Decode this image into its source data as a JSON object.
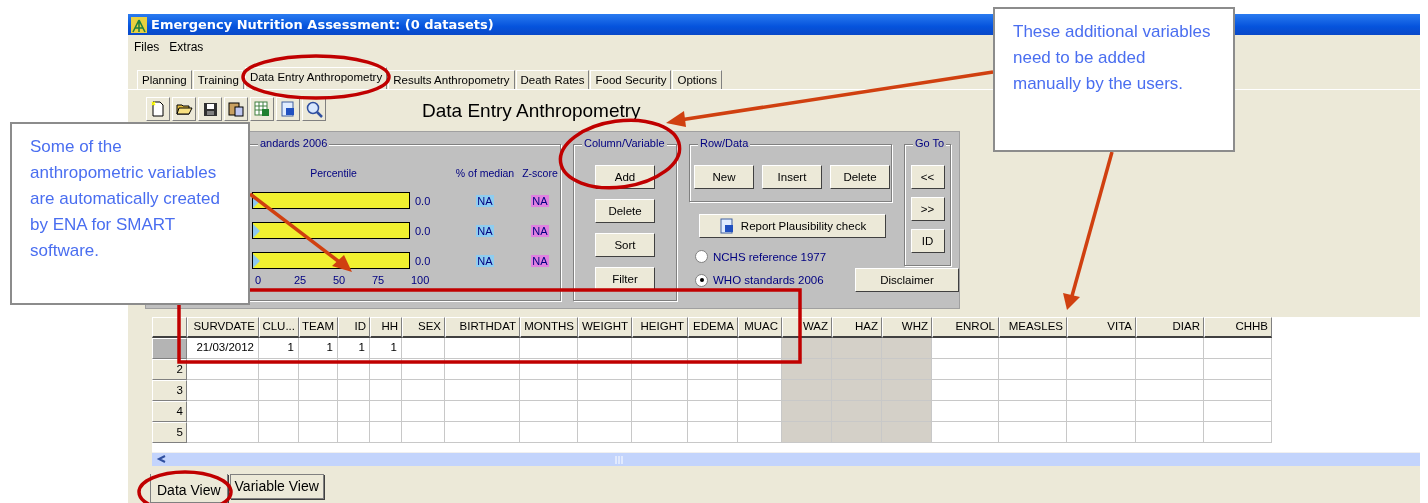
{
  "window": {
    "title": "Emergency Nutrition Assessment:  (0 datasets)"
  },
  "menu": [
    "Files",
    "Extras"
  ],
  "tabs": [
    {
      "label": "Planning",
      "selected": false
    },
    {
      "label": "Training",
      "selected": false
    },
    {
      "label": "Data Entry Anthropometry",
      "selected": true
    },
    {
      "label": "Results Anthropometry",
      "selected": false
    },
    {
      "label": "Death Rates",
      "selected": false
    },
    {
      "label": "Food Security",
      "selected": false
    },
    {
      "label": "Options",
      "selected": false
    }
  ],
  "toolbar": [
    {
      "kind": "new"
    },
    {
      "kind": "open"
    },
    {
      "kind": "save"
    },
    {
      "kind": "clipboard"
    },
    {
      "kind": "spreadsheet"
    },
    {
      "kind": "document"
    },
    {
      "kind": "formula"
    }
  ],
  "page_title": "Data Entry Anthropometry",
  "indicator_group": {
    "title": "andards 2006",
    "header_percentile": "Percentile",
    "header_median": "% of median",
    "header_zscore": "Z-score",
    "rows": [
      {
        "level": 0,
        "value": "0.0",
        "median": "NA",
        "zscore": "NA"
      },
      {
        "level": 0,
        "value": "0.0",
        "median": "NA",
        "zscore": "NA"
      },
      {
        "level": 0,
        "value": "0.0",
        "median": "NA",
        "zscore": "NA"
      }
    ],
    "scale": [
      "0",
      "25",
      "50",
      "75",
      "100"
    ]
  },
  "column_group": {
    "title": "Column/Variable",
    "buttons": [
      "Add",
      "Delete",
      "Sort",
      "Filter"
    ]
  },
  "row_group": {
    "title": "Row/Data",
    "buttons": [
      "New",
      "Insert",
      "Delete"
    ]
  },
  "report_button": "Report Plausibility check",
  "references": [
    {
      "label": "NCHS reference 1977",
      "selected": false
    },
    {
      "label": "WHO standards 2006",
      "selected": true
    }
  ],
  "goto_group": {
    "title": "Go To",
    "buttons": [
      "<<",
      ">>",
      "ID"
    ]
  },
  "disclaimer_button": "Disclaimer",
  "grid": {
    "columns": [
      {
        "label": "SURVDATE",
        "kind": "input"
      },
      {
        "label": "CLU...",
        "kind": "input"
      },
      {
        "label": "TEAM",
        "kind": "input"
      },
      {
        "label": "ID",
        "kind": "input"
      },
      {
        "label": "HH",
        "kind": "input"
      },
      {
        "label": "SEX",
        "kind": "input"
      },
      {
        "label": "BIRTHDAT",
        "kind": "input"
      },
      {
        "label": "MONTHS",
        "kind": "input"
      },
      {
        "label": "WEIGHT",
        "kind": "input"
      },
      {
        "label": "HEIGHT",
        "kind": "input"
      },
      {
        "label": "EDEMA",
        "kind": "input"
      },
      {
        "label": "MUAC",
        "kind": "input"
      },
      {
        "label": "WAZ",
        "kind": "computed"
      },
      {
        "label": "HAZ",
        "kind": "computed"
      },
      {
        "label": "WHZ",
        "kind": "computed"
      },
      {
        "label": "ENROL",
        "kind": "input"
      },
      {
        "label": "MEASLES",
        "kind": "input"
      },
      {
        "label": "VITA",
        "kind": "input"
      },
      {
        "label": "DIAR",
        "kind": "input"
      },
      {
        "label": "CHHB",
        "kind": "input"
      }
    ],
    "rows": [
      {
        "selected": true,
        "cells": [
          "21/03/2012",
          "1",
          "1",
          "1",
          "1"
        ]
      },
      {
        "number": "2",
        "selected": false,
        "cells": []
      },
      {
        "number": "3",
        "selected": false,
        "cells": []
      },
      {
        "number": "4",
        "selected": false,
        "cells": []
      },
      {
        "number": "5",
        "selected": false,
        "cells": []
      }
    ]
  },
  "view_tabs": [
    {
      "label": "Data View",
      "selected": true
    },
    {
      "label": "Variable View",
      "selected": false
    }
  ],
  "callouts": [
    {
      "text": "Some of the anthropometric variables are automatically created by ENA for SMART software."
    },
    {
      "text": "These additional variables need to be added manually by the users."
    }
  ]
}
